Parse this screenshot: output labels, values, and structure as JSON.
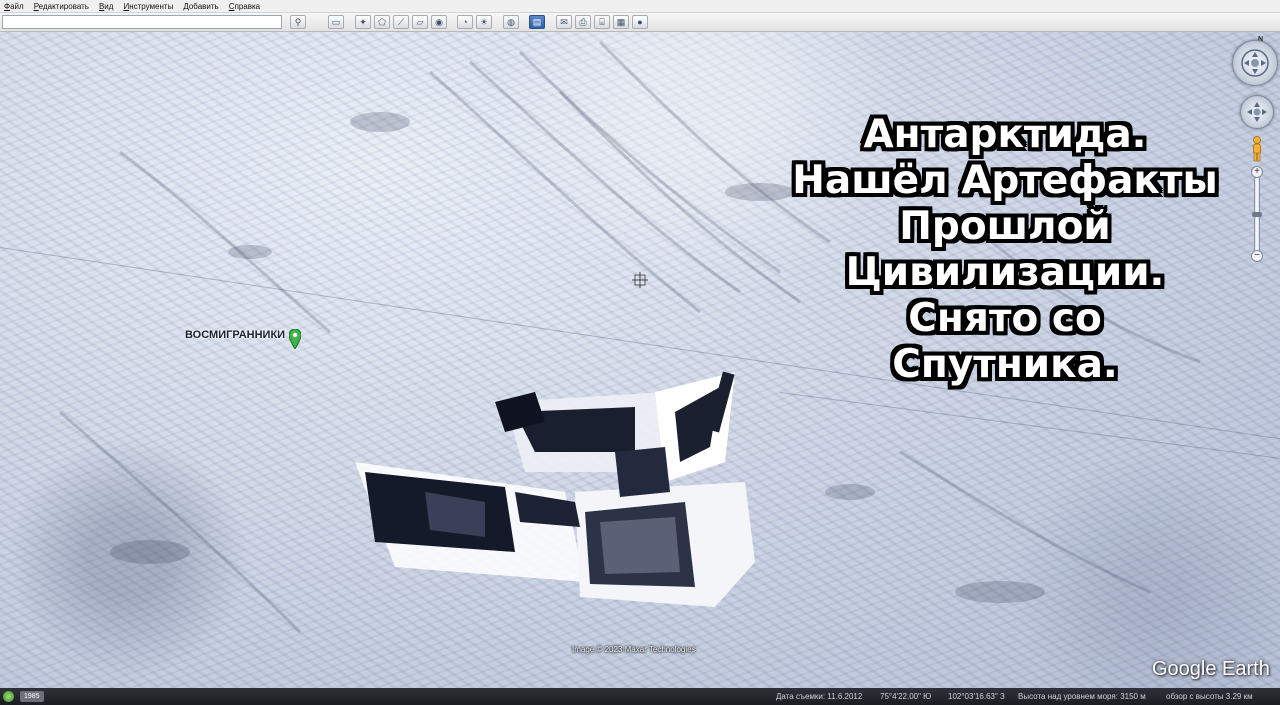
{
  "menu": {
    "items": [
      "Файл",
      "Редактировать",
      "Вид",
      "Инструменты",
      "Добавить",
      "Справка"
    ]
  },
  "toolbar": {
    "search_value": "",
    "buttons": [
      {
        "name": "search-button",
        "icon": "⚲"
      },
      {
        "name": "sidebar-toggle-button",
        "icon": "▭"
      },
      {
        "name": "add-placemark-button",
        "icon": "✦"
      },
      {
        "name": "add-polygon-button",
        "icon": "⬠"
      },
      {
        "name": "add-path-button",
        "icon": "⟋"
      },
      {
        "name": "add-overlay-button",
        "icon": "▱"
      },
      {
        "name": "record-tour-button",
        "icon": "◉"
      },
      {
        "name": "historical-imagery-button",
        "icon": "◔"
      },
      {
        "name": "sunlight-button",
        "icon": "☀"
      },
      {
        "name": "switch-planet-button",
        "icon": "◍"
      },
      {
        "name": "ruler-button",
        "icon": "▤"
      },
      {
        "name": "email-button",
        "icon": "✉"
      },
      {
        "name": "print-button",
        "icon": "⎙"
      },
      {
        "name": "save-image-button",
        "icon": "⌸"
      },
      {
        "name": "view-in-maps-button",
        "icon": "▦"
      },
      {
        "name": "earth-gallery-button",
        "icon": "●"
      }
    ]
  },
  "map": {
    "placemark_label": "ВОСМИГРАННИКИ",
    "attribution": "Image © 2023 Maxar Technologies",
    "logo": "Google Earth",
    "compass_letter": "N"
  },
  "caption": {
    "lines": [
      "Антарктида.",
      "Нашёл Артефакты",
      "Прошлой",
      "Цивилизации.",
      "Снято со",
      "Спутника."
    ]
  },
  "status": {
    "year": "1985",
    "imagery_date": "Дата съемки: 11.6.2012",
    "latitude": "75°4'22.00\" Ю",
    "longitude": "102°03'16.63\" З",
    "elevation": "Высота над уровнем моря: 3150 м",
    "eye_altitude": "обзор с высоты 3.29 км"
  },
  "colors": {
    "pin": "#3fb44a",
    "status_bar": "#1f2226",
    "active_button": "#2c5fa8"
  }
}
